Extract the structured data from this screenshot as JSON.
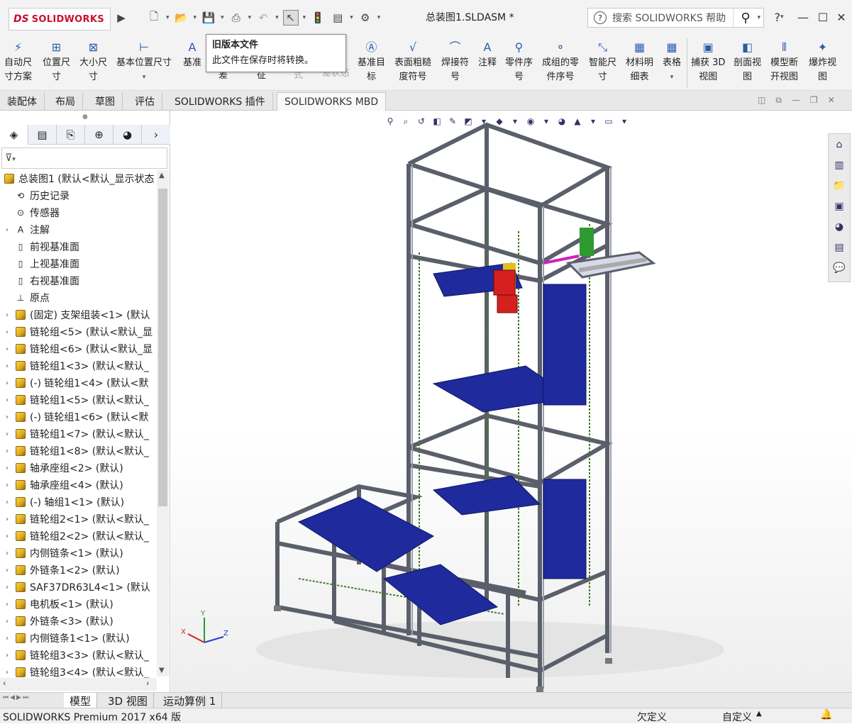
{
  "app": {
    "brand_prefix": "DS",
    "brand": "SOLIDWORKS"
  },
  "title": "总装图1.SLDASM *",
  "search": {
    "placeholder": "搜索 SOLIDWORKS 帮助"
  },
  "window_buttons": {
    "help": "?",
    "minimize": "—",
    "maximize": "☐",
    "close": "✕"
  },
  "tooltip": {
    "title": "旧版本文件",
    "body": "此文件在保存时将转换。"
  },
  "commands": [
    {
      "line1": "自动尺",
      "line2": "寸方案",
      "icon": "auto-dimension-icon"
    },
    {
      "line1": "位置尺",
      "line2": "寸",
      "icon": "location-dimension-icon"
    },
    {
      "line1": "大小尺",
      "line2": "寸",
      "icon": "size-dimension-icon"
    },
    {
      "line1": "基本位置尺寸",
      "line2": "",
      "icon": "basic-location-dimension-icon"
    },
    {
      "line1": "基准",
      "line2": "",
      "icon": "datum-icon"
    },
    {
      "line1": "差",
      "line2": "",
      "icon": ""
    },
    {
      "line1": "征",
      "line2": "",
      "icon": ""
    },
    {
      "line1": "式",
      "line2": "",
      "icon": ""
    },
    {
      "line1": "公",
      "line2": "差状态",
      "icon": ""
    },
    {
      "line1": "基准目",
      "line2": "标",
      "icon": "datum-target-icon"
    },
    {
      "line1": "表面粗糙",
      "line2": "度符号",
      "icon": "surface-finish-icon"
    },
    {
      "line1": "焊接符",
      "line2": "号",
      "icon": "weld-symbol-icon"
    },
    {
      "line1": "注释",
      "line2": "",
      "icon": "note-icon"
    },
    {
      "line1": "零件序",
      "line2": "号",
      "icon": "balloon-icon"
    },
    {
      "line1": "成组的零",
      "line2": "件序号",
      "icon": "stacked-balloon-icon"
    },
    {
      "line1": "智能尺",
      "line2": "寸",
      "icon": "smart-dimension-icon"
    },
    {
      "line1": "材料明",
      "line2": "细表",
      "icon": "bom-icon"
    },
    {
      "line1": "表格",
      "line2": "",
      "icon": "table-icon"
    },
    {
      "line1": "捕获 3D",
      "line2": "视图",
      "icon": "capture-3d-view-icon"
    },
    {
      "line1": "剖面视",
      "line2": "图",
      "icon": "section-view-icon"
    },
    {
      "line1": "模型断",
      "line2": "开视图",
      "icon": "model-break-view-icon"
    },
    {
      "line1": "爆炸视",
      "line2": "图",
      "icon": "exploded-view-icon"
    }
  ],
  "tabs": [
    "装配体",
    "布局",
    "草图",
    "评估",
    "SOLIDWORKS 插件",
    "SOLIDWORKS MBD"
  ],
  "tree": {
    "root": "总装图1 (默认<默认_显示状态",
    "items": [
      {
        "label": "历史记录",
        "exp": false,
        "icon": "history-icon"
      },
      {
        "label": "传感器",
        "exp": false,
        "icon": "sensor-icon"
      },
      {
        "label": "注解",
        "exp": true,
        "icon": "annotation-icon"
      },
      {
        "label": "前视基准面",
        "exp": false,
        "icon": "plane-icon"
      },
      {
        "label": "上视基准面",
        "exp": false,
        "icon": "plane-icon"
      },
      {
        "label": "右视基准面",
        "exp": false,
        "icon": "plane-icon"
      },
      {
        "label": "原点",
        "exp": false,
        "icon": "origin-icon"
      },
      {
        "label": "(固定) 支架组装<1> (默认",
        "exp": true,
        "icon": "assembly-icon"
      },
      {
        "label": "链轮组<5> (默认<默认_显",
        "exp": true,
        "icon": "assembly-icon"
      },
      {
        "label": "链轮组<6> (默认<默认_显",
        "exp": true,
        "icon": "assembly-icon"
      },
      {
        "label": "链轮组1<3> (默认<默认_",
        "exp": true,
        "icon": "assembly-icon"
      },
      {
        "label": "(-) 链轮组1<4> (默认<默",
        "exp": true,
        "icon": "assembly-icon"
      },
      {
        "label": "链轮组1<5> (默认<默认_",
        "exp": true,
        "icon": "assembly-icon"
      },
      {
        "label": "(-) 链轮组1<6> (默认<默",
        "exp": true,
        "icon": "assembly-icon"
      },
      {
        "label": "链轮组1<7> (默认<默认_",
        "exp": true,
        "icon": "assembly-icon"
      },
      {
        "label": "链轮组1<8> (默认<默认_",
        "exp": true,
        "icon": "assembly-icon"
      },
      {
        "label": "轴承座组<2> (默认)",
        "exp": true,
        "icon": "assembly-icon"
      },
      {
        "label": "轴承座组<4> (默认)",
        "exp": true,
        "icon": "assembly-icon"
      },
      {
        "label": "(-) 轴组1<1> (默认)",
        "exp": true,
        "icon": "assembly-icon"
      },
      {
        "label": "链轮组2<1> (默认<默认_",
        "exp": true,
        "icon": "assembly-icon"
      },
      {
        "label": "链轮组2<2> (默认<默认_",
        "exp": true,
        "icon": "assembly-icon"
      },
      {
        "label": "内侧链条<1> (默认)",
        "exp": true,
        "icon": "assembly-icon"
      },
      {
        "label": "外链条1<2> (默认)",
        "exp": true,
        "icon": "assembly-icon"
      },
      {
        "label": "SAF37DR63L4<1> (默认",
        "exp": true,
        "icon": "assembly-icon"
      },
      {
        "label": "电机板<1> (默认)",
        "exp": true,
        "icon": "assembly-icon"
      },
      {
        "label": "外链条<3> (默认)",
        "exp": true,
        "icon": "assembly-icon"
      },
      {
        "label": "内侧链条1<1> (默认)",
        "exp": true,
        "icon": "assembly-icon"
      },
      {
        "label": "链轮组3<3> (默认<默认_",
        "exp": true,
        "icon": "assembly-icon"
      },
      {
        "label": "链轮组3<4> (默认<默认_",
        "exp": true,
        "icon": "assembly-icon"
      }
    ]
  },
  "bottom_tabs": [
    "模型",
    "3D 视图",
    "运动算例 1"
  ],
  "status": {
    "left": "SOLIDWORKS Premium 2017 x64 版",
    "mid": "欠定义",
    "right": "自定义"
  },
  "triad": {
    "x": "X",
    "y": "Y",
    "z": "Z"
  },
  "colors": {
    "frame": "#5a5f6b",
    "tray": "#1f2a9c",
    "motor": "#d62020",
    "roller": "#d8d8e8",
    "brand": "#c8102e",
    "chain": "#4a7a2a"
  }
}
